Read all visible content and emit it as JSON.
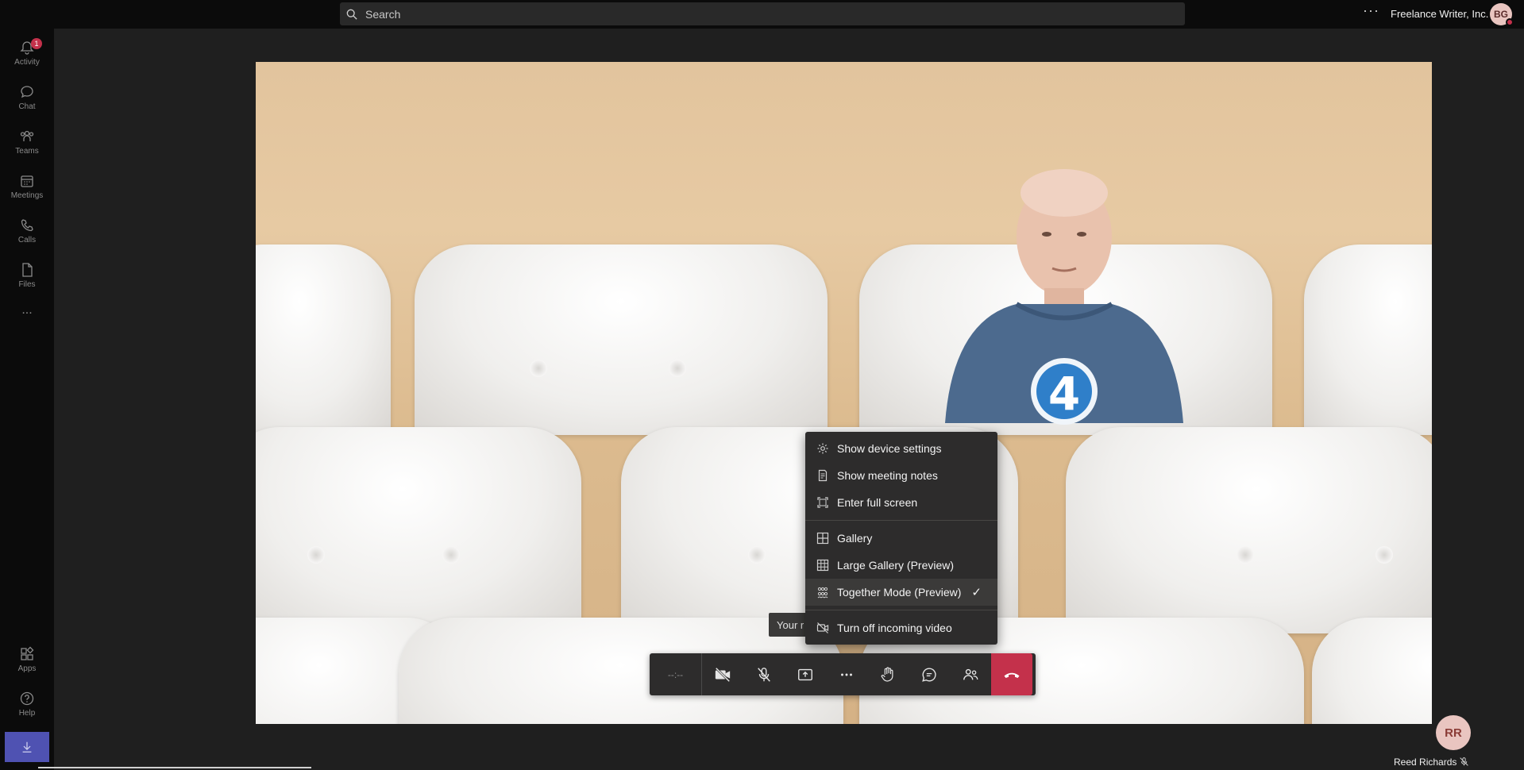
{
  "search": {
    "placeholder": "Search"
  },
  "header": {
    "org": "Freelance Writer, Inc.",
    "avatar_initials": "BG"
  },
  "rail": {
    "items": [
      {
        "label": "Activity",
        "badge": "1",
        "icon": "bell-icon"
      },
      {
        "label": "Chat",
        "icon": "chat-icon"
      },
      {
        "label": "Teams",
        "icon": "teams-icon"
      },
      {
        "label": "Meetings",
        "icon": "calendar-icon"
      },
      {
        "label": "Calls",
        "icon": "phone-icon"
      },
      {
        "label": "Files",
        "icon": "file-icon"
      }
    ],
    "more": "...",
    "apps": "Apps",
    "help": "Help"
  },
  "menu": {
    "items": [
      {
        "label": "Show device settings",
        "icon": "gear-icon"
      },
      {
        "label": "Show meeting notes",
        "icon": "notes-icon"
      },
      {
        "label": "Enter full screen",
        "icon": "fullscreen-icon"
      },
      {
        "label": "Gallery",
        "icon": "grid-icon"
      },
      {
        "label": "Large Gallery (Preview)",
        "icon": "large-grid-icon"
      },
      {
        "label": "Together Mode (Preview)",
        "icon": "together-mode-icon",
        "checked": true
      },
      {
        "label": "Turn off incoming video",
        "icon": "video-off-icon"
      }
    ]
  },
  "tooltip": {
    "text": "Your r"
  },
  "callbar": {
    "timer": "--:--"
  },
  "participant": {
    "initials": "RR",
    "name": "Reed Richards"
  },
  "colors": {
    "accent": "#4f52b2",
    "hangup": "#c4314b",
    "menu_bg": "#2d2c2c"
  }
}
